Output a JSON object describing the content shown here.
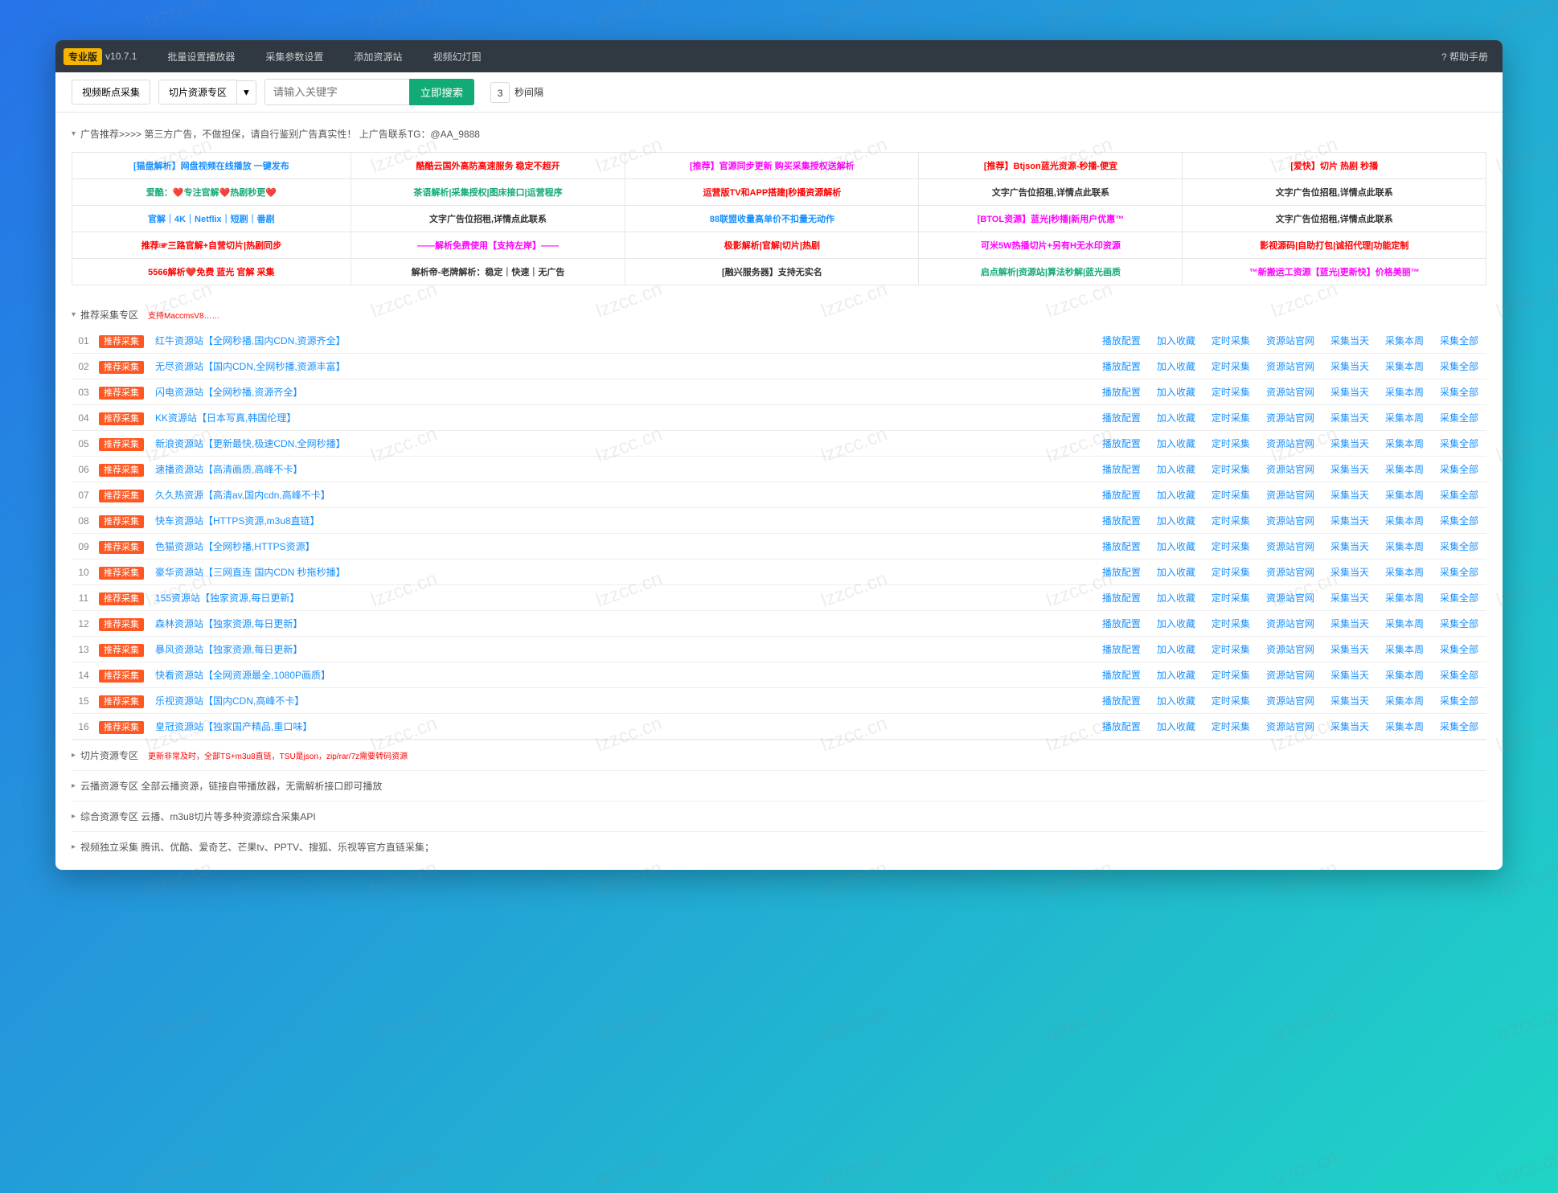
{
  "logo": "专业版",
  "version": "v10.7.1",
  "nav": [
    "批量设置播放器",
    "采集参数设置",
    "添加资源站",
    "视频幻灯图"
  ],
  "help": "? 帮助手册",
  "toolbar": {
    "btn1": "视频断点采集",
    "btn2": "切片资源专区",
    "search_ph": "请输入关键字",
    "search_btn": "立即搜索",
    "interval_num": "3",
    "interval_label": "秒间隔"
  },
  "ad_header": "广告推荐>>>>   第三方广告，不做担保，请自行鉴别广告真实性！ 上广告联系TG：@AA_9888",
  "ads": [
    [
      {
        "t": "[猫盘解析】网盘视频在线播放 一键发布",
        "c": "#1890ff"
      },
      {
        "t": "酷酷云国外高防高速服务 稳定不超开",
        "c": "#f00"
      },
      {
        "t": "[推荐】官源同步更新 购买采集授权送解析",
        "c": "#ff00ff"
      },
      {
        "t": "[推荐】Btjson蓝光资源-秒播-便宜",
        "c": "#f00"
      },
      {
        "t": "[爱快】切片 热剧 秒播",
        "c": "#f00"
      }
    ],
    [
      {
        "t": "爱酷：❤️专注官解❤️热剧秒更❤️",
        "c": "#13ab75"
      },
      {
        "t": "茶语解析|采集授权|图床接口|运营程序",
        "c": "#13ab75"
      },
      {
        "t": "运营版TV和APP搭建|秒播资源解析",
        "c": "#f00"
      },
      {
        "t": "文字广告位招租,详情点此联系",
        "c": "#333"
      },
      {
        "t": "文字广告位招租,详情点此联系",
        "c": "#333"
      }
    ],
    [
      {
        "t": "官解｜4K｜Netflix｜短剧｜番剧",
        "c": "#1890ff"
      },
      {
        "t": "文字广告位招租,详情点此联系",
        "c": "#333"
      },
      {
        "t": "88联盟收量高单价不扣量无动作",
        "c": "#1890ff"
      },
      {
        "t": "[BTOL资源】蓝光|秒播|新用户优惠™",
        "c": "#ff00ff"
      },
      {
        "t": "文字广告位招租,详情点此联系",
        "c": "#333"
      }
    ],
    [
      {
        "t": "推荐☞三路官解+自营切片|热剧同步",
        "c": "#f00"
      },
      {
        "t": "——解析免费使用【支持左岸】——",
        "c": "#ff00ff"
      },
      {
        "t": "极影解析|官解|切片|热剧",
        "c": "#f00"
      },
      {
        "t": "可米5W热播切片+另有H无水印资源",
        "c": "#ff00ff"
      },
      {
        "t": "影视源码|自助打包|诚招代理|功能定制",
        "c": "#f00"
      }
    ],
    [
      {
        "t": "5566解析❤️免费 蓝光 官解 采集",
        "c": "#f00"
      },
      {
        "t": "解析帝-老牌解析：稳定｜快速｜无广告",
        "c": "#333"
      },
      {
        "t": "[融兴服务器】支持无实名",
        "c": "#333"
      },
      {
        "t": "启点解析|资源站|算法秒解|蓝光画质",
        "c": "#13ab75"
      },
      {
        "t": "™新搬运工资源【蓝光|更新快】价格美丽™",
        "c": "#ff00ff"
      }
    ]
  ],
  "rec_header": "推荐采集专区",
  "rec_note": "支持MaccmsV8……",
  "tag_label": "推荐采集",
  "actions": [
    "播放配置",
    "加入收藏",
    "定时采集",
    "资源站官网",
    "采集当天",
    "采集本周",
    "采集全部"
  ],
  "items": [
    {
      "n": "01",
      "t": "红牛资源站【全网秒播,国内CDN,资源齐全】"
    },
    {
      "n": "02",
      "t": "无尽资源站【国内CDN,全网秒播,资源丰富】"
    },
    {
      "n": "03",
      "t": "闪电资源站【全网秒播,资源齐全】"
    },
    {
      "n": "04",
      "t": "KK资源站【日本写真,韩国伦理】"
    },
    {
      "n": "05",
      "t": "新浪资源站【更新最快,极速CDN,全网秒播】"
    },
    {
      "n": "06",
      "t": "速播资源站【高清画质,高峰不卡】"
    },
    {
      "n": "07",
      "t": "久久热资源【高清av,国内cdn,高峰不卡】"
    },
    {
      "n": "08",
      "t": "快车资源站【HTTPS资源,m3u8直链】"
    },
    {
      "n": "09",
      "t": "色猫资源站【全网秒播,HTTPS资源】"
    },
    {
      "n": "10",
      "t": "豪华资源站【三网直连 国内CDN 秒拖秒播】"
    },
    {
      "n": "11",
      "t": "155资源站【独家资源,每日更新】"
    },
    {
      "n": "12",
      "t": "森林资源站【独家资源,每日更新】"
    },
    {
      "n": "13",
      "t": "暴风资源站【独家资源,每日更新】"
    },
    {
      "n": "14",
      "t": "快看资源站【全网资源最全,1080P画质】"
    },
    {
      "n": "15",
      "t": "乐视资源站【国内CDN,高峰不卡】"
    },
    {
      "n": "16",
      "t": "皇冠资源站【独家国产精品,重口味】"
    }
  ],
  "sub_sections": [
    {
      "t": "切片资源专区",
      "note": "更新非常及时，全部TS+m3u8直链，TSU是json，zip/rar/7z需要转码资源"
    },
    {
      "t": "云播资源专区 全部云播资源，链接自带播放器，无需解析接口即可播放",
      "note": ""
    },
    {
      "t": "综合资源专区 云播、m3u8切片等多种资源综合采集API",
      "note": ""
    },
    {
      "t": "视频独立采集 腾讯、优酷、爱奇艺、芒果tv、PPTV、搜狐、乐视等官方直链采集；",
      "note": ""
    }
  ],
  "watermark": "lzzcc.cn"
}
